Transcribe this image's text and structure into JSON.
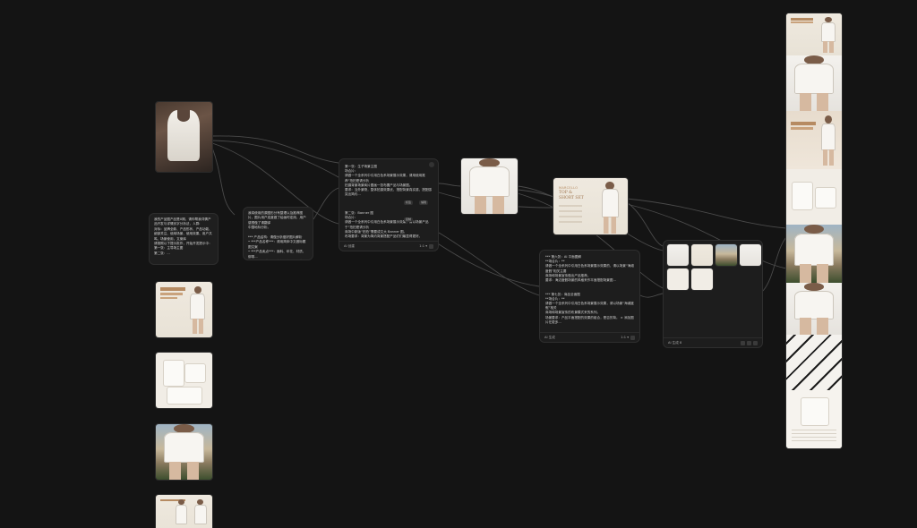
{
  "app": {
    "name": "",
    "canvas_bg": "#141414"
  },
  "colors": {
    "node_bg": "#1f1f1f",
    "border": "#2d2d2d",
    "edge": "#4a4a4a",
    "accent": "#b68b62"
  },
  "source_images": {
    "items": [
      {
        "name": "sleeveless-top-photo",
        "kind": "product-photo"
      },
      {
        "name": "poster-thumbnail-1",
        "kind": "poster"
      },
      {
        "name": "flatlay-thumbnail",
        "kind": "flatlay"
      },
      {
        "name": "outdoor-thumbnail",
        "kind": "outdoor"
      },
      {
        "name": "poster-thumbnail-2",
        "kind": "poster"
      }
    ]
  },
  "notes": {
    "requirements": "我的产品图产品是X期，请你帮我详情产品开发与详情页字分析法，人群:\n对标：品牌全款、产品形状、产品功能、细部关注、使用场景、使用效果、用户共鸣、场景使用，文案库\n请按照以下提示批作，开始开发提示中：\n第一张：主导场主图\n第二张：...",
    "analysis": "我将使用的原图形分有整理以及推荐图片，图片用户连度做了绘画时定用，用户感想做了请翻译\n中国地标分析。\n\n*** 产品结构：请做分析做好图片解析\n• ***产品名称***：请用简体中文做标题图文案\n• ***产品卖点***：面料、印花、材质、绑带...\n• ***产品优势***：内部适合通用，并经营推荐\n• ...请仔细了解一下再开始创建产品的的图文案。"
  },
  "prompt_panel": {
    "text": "第一张：生子场景主图\n场合片：\n请做一个全系列中引用白色系场景展示效果，请用使用推荐“拍拍是请分析\n拍摄背景场景商片图画一张布置产品与场景图。\n要求：当外景物，整体拍摄效果优，搭配背景真实感，搭配感突出简约...\n\n\n\n第二张：Banner 图\n场合片：\n请做一个全系列中引用白色系场景展示效果，请以场景产品于“拍拍是请分析\n商场中新版“拍拍”需要成文大 Banner 图。\n布场要求：背景为简约背景搭配产品们们最显得更好。",
    "footer_label": "AI 创建",
    "footer_right": "1:1 ▾",
    "tags": [
      "标签",
      "编辑",
      "复制"
    ]
  },
  "result_panel": {
    "text": "*** 第六张：AI 平面图解\n**场合片：**\n请做一个全系列中引用白色系场景展示效果的，请以场景“海滩度假”相关主要\n商场和场景宣传做出产品推荐。\n要求：海边度假场景的风格来作平面搭配场景图...\n\n\n*** 第七张：商品全面图\n**场合片：**\n请做一个全系列中引用白色系场景展示效果，请以场景“海滩度假”相关\n商场和场景宣传的布景模式来的系列。\n场景要求：产品平面搭配的效果的组合，是否的背。 × 添加图片在更多...\n\n\n*** 第八张：细部图产品详情",
    "footer_label": "AI 生成",
    "footer_right": "1:1 ▾"
  },
  "grid_panel": {
    "footer_label": "AI 生成 8",
    "thumb_count": 6
  },
  "poster_output": {
    "brand_line": "MARCELLO",
    "title_line1": "TOP &",
    "title_line2": "SHORT SET"
  },
  "long_detail_page": {
    "sections": [
      "hero-poster",
      "studio-model",
      "poster-feature",
      "flatlay",
      "outdoor-model",
      "two-models",
      "pattern-closeup",
      "size-chart"
    ],
    "hero_title": "MARCELLO TOP & SHORT SET"
  }
}
